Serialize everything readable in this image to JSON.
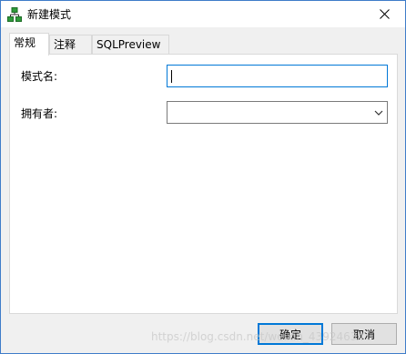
{
  "window": {
    "title": "新建模式",
    "app_icon": "schema-tree-icon",
    "close_icon": "close-icon"
  },
  "tabs": [
    {
      "label": "常规",
      "active": true
    },
    {
      "label": "注释",
      "active": false
    },
    {
      "label": "SQLPreview",
      "active": false
    }
  ],
  "form": {
    "schema_name_label": "模式名:",
    "schema_name_value": "",
    "owner_label": "拥有者:",
    "owner_value": ""
  },
  "buttons": {
    "ok": "确定",
    "cancel": "取消"
  },
  "watermark": "https://blog.csdn.net/weixin_43924634",
  "colors": {
    "focus_border": "#0078d7",
    "window_border": "#3f7cc9",
    "app_icon_green": "#2e9b3a"
  }
}
